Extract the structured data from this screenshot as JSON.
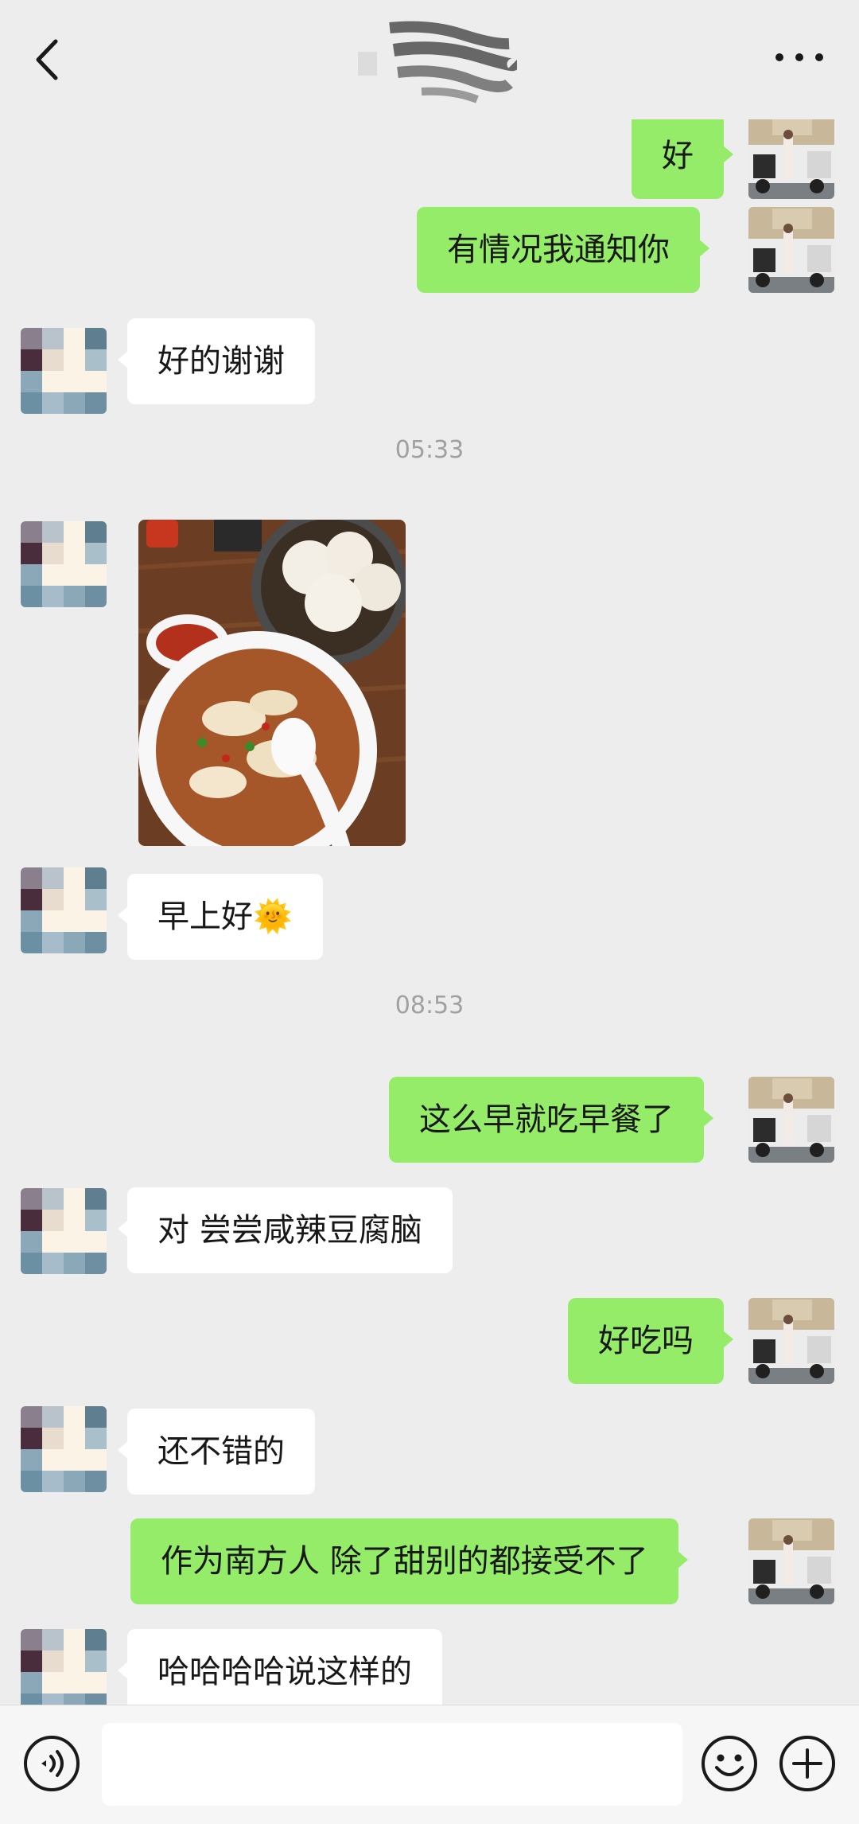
{
  "header": {
    "back_icon": "chevron-left-icon",
    "title_obscured": true,
    "more_icon": "more-dots-icon"
  },
  "colors": {
    "background": "#ededed",
    "incoming_bubble": "#ffffff",
    "outgoing_bubble": "#95ec69",
    "timestamp": "#a0a0a0"
  },
  "messages": [
    {
      "side": "out",
      "text": "好"
    },
    {
      "side": "out",
      "text": "有情况我通知你"
    },
    {
      "side": "in",
      "text": "好的谢谢"
    },
    {
      "type": "time",
      "text": "05:33"
    },
    {
      "side": "in",
      "type": "image"
    },
    {
      "side": "in",
      "text": "早上好🌞"
    },
    {
      "type": "time",
      "text": "08:53"
    },
    {
      "side": "out",
      "text": "这么早就吃早餐了"
    },
    {
      "side": "in",
      "text": "对 尝尝咸辣豆腐脑"
    },
    {
      "side": "out",
      "text": "好吃吗"
    },
    {
      "side": "in",
      "text": "还不错的"
    },
    {
      "side": "out",
      "text": "作为南方人 除了甜别的都接受不了"
    },
    {
      "side": "in",
      "text": "哈哈哈哈说这样的"
    }
  ],
  "input_bar": {
    "voice_icon": "voice-icon",
    "text_value": "",
    "emoji_icon": "emoji-icon",
    "plus_icon": "plus-icon"
  }
}
